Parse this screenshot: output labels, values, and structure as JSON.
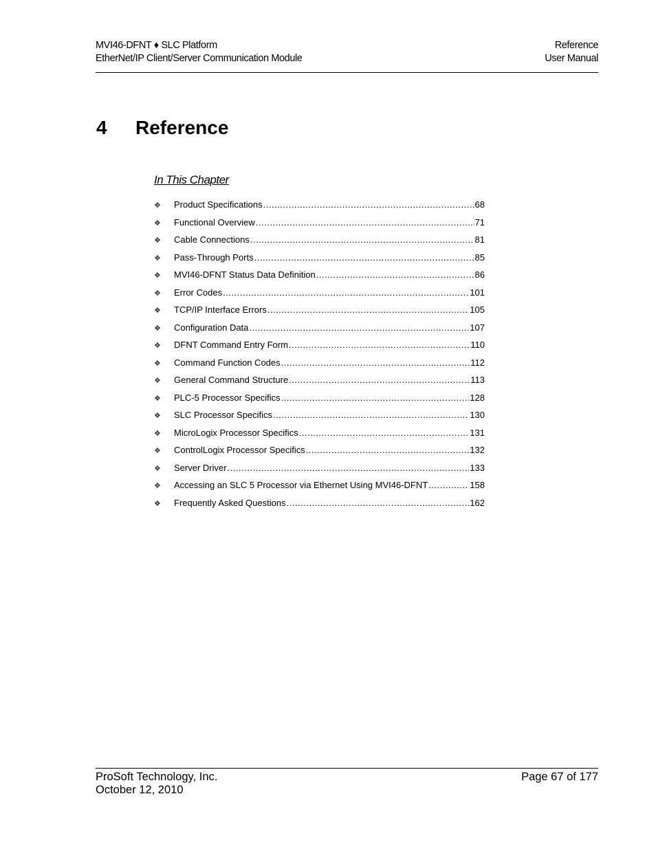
{
  "header": {
    "left_line1": "MVI46-DFNT ♦ SLC Platform",
    "left_line2": "EtherNet/IP Client/Server Communication Module",
    "right_line1": "Reference",
    "right_line2": "User Manual"
  },
  "chapter": {
    "number": "4",
    "title": "Reference"
  },
  "in_this_chapter": {
    "heading": "In This Chapter",
    "bullet_icon": "four-diamond-bullet-icon",
    "bullet_glyph": "❖",
    "items": [
      {
        "label": "Product Specifications",
        "page": "68"
      },
      {
        "label": "Functional Overview",
        "page": "71"
      },
      {
        "label": "Cable Connections",
        "page": "81"
      },
      {
        "label": "Pass-Through Ports",
        "page": "85"
      },
      {
        "label": "MVI46-DFNT Status Data Definition",
        "page": "86"
      },
      {
        "label": "Error Codes",
        "page": "101"
      },
      {
        "label": "TCP/IP Interface Errors",
        "page": "105"
      },
      {
        "label": "Configuration Data",
        "page": "107"
      },
      {
        "label": "DFNT Command Entry Form",
        "page": "110"
      },
      {
        "label": "Command Function Codes",
        "page": "112"
      },
      {
        "label": "General Command Structure",
        "page": "113"
      },
      {
        "label": "PLC-5 Processor Specifics",
        "page": "128"
      },
      {
        "label": "SLC Processor Specifics",
        "page": "130"
      },
      {
        "label": "MicroLogix Processor Specifics",
        "page": "131"
      },
      {
        "label": "ControlLogix Processor Specifics",
        "page": "132"
      },
      {
        "label": "Server Driver",
        "page": "133"
      },
      {
        "label": "Accessing an SLC 5 Processor via Ethernet Using MVI46-DFNT",
        "page": "158"
      },
      {
        "label": "Frequently Asked Questions",
        "page": "162"
      }
    ]
  },
  "footer": {
    "company": "ProSoft Technology, Inc.",
    "date": "October 12, 2010",
    "page_info": "Page 67 of 177"
  }
}
